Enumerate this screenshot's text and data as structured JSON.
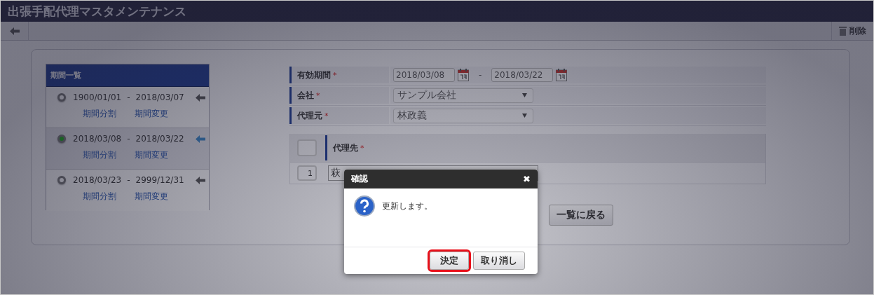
{
  "title": "出張手配代理マスタメンテナンス",
  "toolbar": {
    "delete_label": "削除"
  },
  "period_list": {
    "title": "期間一覧",
    "periods": [
      {
        "start": "1900/01/01",
        "separator": "-",
        "end": "2018/03/07",
        "selected": false,
        "links": [
          "期間分割",
          "期間変更"
        ]
      },
      {
        "start": "2018/03/08",
        "separator": "-",
        "end": "2018/03/22",
        "selected": true,
        "links": [
          "期間分割",
          "期間変更"
        ]
      },
      {
        "start": "2018/03/23",
        "separator": "-",
        "end": "2999/12/31",
        "selected": false,
        "links": [
          "期間分割",
          "期間変更"
        ]
      }
    ]
  },
  "form": {
    "fields": [
      {
        "kind": "date_range",
        "label": "有効期間",
        "required_mark": "*",
        "start": "2018/03/08",
        "separator": "-",
        "end": "2018/03/22"
      },
      {
        "kind": "select",
        "label": "会社",
        "required_mark": "*",
        "value": "サンプル会社"
      },
      {
        "kind": "select",
        "label": "代理元",
        "required_mark": "*",
        "value": "林政義"
      }
    ],
    "table": {
      "checked": false,
      "column": "代理先",
      "required_mark": "*",
      "rows": [
        {
          "number": "1",
          "value": "萩"
        }
      ]
    },
    "buttons": [
      "一覧に戻る"
    ]
  },
  "dialog": {
    "title": "確認",
    "close": "✖",
    "message": "更新します。",
    "buttons": [
      {
        "label": "決定",
        "highlighted": true
      },
      {
        "label": "取り消し",
        "highlighted": false
      }
    ]
  }
}
